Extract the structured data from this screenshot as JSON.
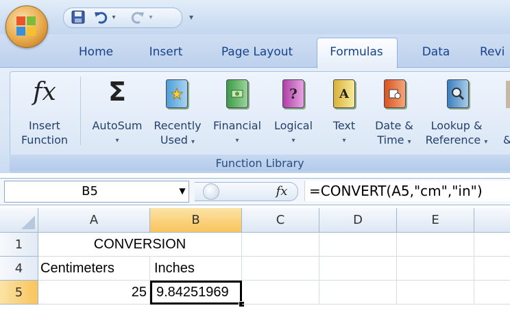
{
  "quick_access": {
    "save_icon": "save-icon",
    "undo_icon": "undo-icon",
    "redo_icon": "redo-icon",
    "customize_glyph": "▾"
  },
  "tabs": [
    "Home",
    "Insert",
    "Page Layout",
    "Formulas",
    "Data",
    "Revi"
  ],
  "active_tab": "Formulas",
  "ribbon": {
    "group_label": "Function Library",
    "buttons": [
      {
        "line1": "Insert",
        "line2": "Function",
        "arrow": ""
      },
      {
        "line1": "AutoSum",
        "line2": "",
        "arrow": "▾"
      },
      {
        "line1": "Recently",
        "line2": "Used",
        "arrow": "▾"
      },
      {
        "line1": "Financial",
        "line2": "",
        "arrow": "▾"
      },
      {
        "line1": "Logical",
        "line2": "",
        "arrow": "▾"
      },
      {
        "line1": "Text",
        "line2": "",
        "arrow": "▾"
      },
      {
        "line1": "Date &",
        "line2": "Time",
        "arrow": "▾"
      },
      {
        "line1": "Lookup &",
        "line2": "Reference",
        "arrow": "▾"
      }
    ],
    "fx_glyph": "fx",
    "sigma_glyph": "Σ",
    "logical_glyph": "?",
    "text_glyph": "A",
    "truncated_glyph": "&"
  },
  "formula_bar": {
    "name_box": "B5",
    "fx_glyph": "fx",
    "formula": "=CONVERT(A5,\"cm\",\"in\")"
  },
  "sheet": {
    "columns": [
      "A",
      "B",
      "C",
      "D",
      "E"
    ],
    "selected_column": "B",
    "rows": [
      {
        "label": "1",
        "a": "CONVERSION",
        "b": ""
      },
      {
        "label": "4",
        "a": "Centimeters",
        "b": "Inches"
      },
      {
        "label": "5",
        "a": "25",
        "b": "9.84251969"
      }
    ],
    "selected_row": "5",
    "active_cell": "B5"
  },
  "colors": {
    "tab_text": "#15428b",
    "selection_header": "#f9c45c",
    "grid_line": "#d4dce8"
  }
}
